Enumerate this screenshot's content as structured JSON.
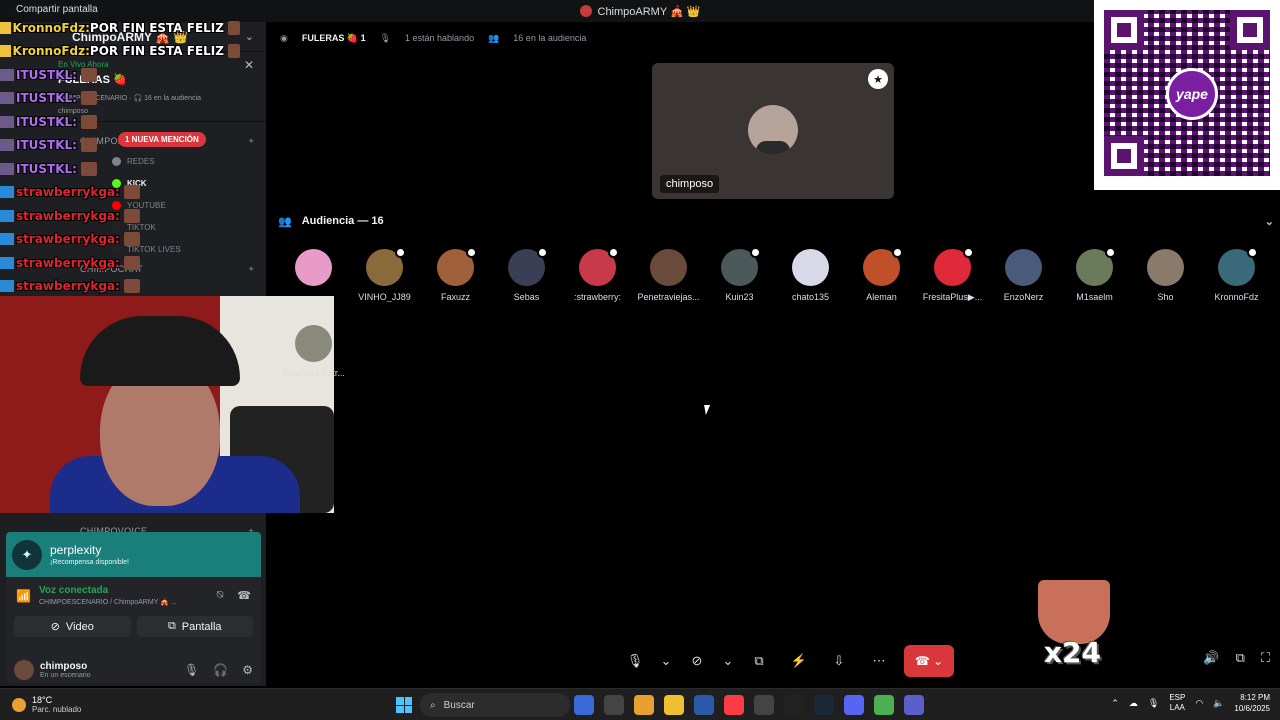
{
  "window": {
    "title": "ChimpoARMY 🎪 👑",
    "share_label": "Compartir pantalla"
  },
  "sidebar": {
    "server_name": "ChimpoARMY 🎪 👑",
    "live_label": "En Vivo Ahora",
    "stage_name": "FULERAS 🍓",
    "stage_meta_scenario": "CHIMPOESCENARIO",
    "stage_meta_audience": "16 en la audiencia",
    "stage_sub": "chimposo",
    "mention_pill": "1 NUEVA MENCIÓN",
    "categories": [
      {
        "label": "CHIMPOREDES"
      },
      {
        "label": "CHIMPOCHAT"
      },
      {
        "label": "CHIMPOVOICE"
      }
    ],
    "channels": [
      {
        "label": "REDES",
        "color": "#80848e"
      },
      {
        "label": "KICK",
        "color": "#53fc18"
      },
      {
        "label": "YOUTUBE",
        "color": "#ff0000"
      },
      {
        "label": "TIKTOK",
        "color": "#222222"
      },
      {
        "label": "TIKTOK LIVES",
        "color": "#222222"
      }
    ]
  },
  "chat_overlay": [
    {
      "nick": "KronnoFdz:",
      "msg": " POR FIN ESTA FELIZ",
      "cls": "nick-kronno"
    },
    {
      "nick": "KronnoFdz:",
      "msg": " POR FIN ESTA FELIZ",
      "cls": "nick-kronno"
    },
    {
      "nick": "ITUSTKL:",
      "msg": "",
      "cls": "nick-itus"
    },
    {
      "nick": "ITUSTKL:",
      "msg": "",
      "cls": "nick-itus"
    },
    {
      "nick": "ITUSTKL:",
      "msg": "",
      "cls": "nick-itus"
    },
    {
      "nick": "ITUSTKL:",
      "msg": "",
      "cls": "nick-itus"
    },
    {
      "nick": "ITUSTKL:",
      "msg": "",
      "cls": "nick-itus"
    },
    {
      "nick": "strawberrykga:",
      "msg": "",
      "cls": "nick-straw"
    },
    {
      "nick": "strawberrykga:",
      "msg": "",
      "cls": "nick-straw"
    },
    {
      "nick": "strawberrykga:",
      "msg": "",
      "cls": "nick-straw"
    },
    {
      "nick": "strawberrykga:",
      "msg": "",
      "cls": "nick-straw"
    },
    {
      "nick": "strawberrykga:",
      "msg": "",
      "cls": "nick-straw"
    }
  ],
  "reward": {
    "title": "perplexity",
    "subtitle": "¡Recompensa disponible!"
  },
  "voice": {
    "status": "Voz conectada",
    "location": "CHIMPOESCENARIO / ChimpoARMY 🎪 ...",
    "video_label": "Video",
    "screen_label": "Pantalla"
  },
  "user": {
    "name": "chimposo",
    "status": "En un escenario"
  },
  "stage": {
    "name": "FULERAS 🍓 1",
    "speaking": "1 están hablando",
    "audience": "16 en la audiencia",
    "speaker_name": "chimposo",
    "audience_header": "Audiencia — 16"
  },
  "audience": [
    {
      "name": "",
      "color": "#e89ac8",
      "badge": false
    },
    {
      "name": "VINHO_JJ89",
      "color": "#8a6a3a",
      "badge": true
    },
    {
      "name": "Faxuzz",
      "color": "#a0603a",
      "badge": true
    },
    {
      "name": "Sebas",
      "color": "#3a3f55",
      "badge": true
    },
    {
      "name": ":strawberry:",
      "color": "#c83a4a",
      "badge": true
    },
    {
      "name": "Penetraviejas...",
      "color": "#6a4a3a",
      "badge": false
    },
    {
      "name": "Kuin23",
      "color": "#4a5a5a",
      "badge": true
    },
    {
      "name": "chato135",
      "color": "#d8d8e8",
      "badge": false
    },
    {
      "name": "Aleman",
      "color": "#c0502a",
      "badge": true
    },
    {
      "name": "FresitaPlus▶...",
      "color": "#e02a3a",
      "badge": true
    },
    {
      "name": "EnzoNerz",
      "color": "#4a5a7a",
      "badge": false
    },
    {
      "name": "M1saelm",
      "color": "#6a7a5a",
      "badge": true
    },
    {
      "name": "Sho",
      "color": "#8a7a6a",
      "badge": false
    },
    {
      "name": "KronnoFdz",
      "color": "#3a6a7a",
      "badge": true
    },
    {
      "name": "Yarens11 Extr...",
      "color": "#8a8a7a",
      "badge": false
    }
  ],
  "overlay_emote": {
    "text": "x24"
  },
  "taskbar": {
    "temp": "18°C",
    "condition": "Parc. nublado",
    "search_placeholder": "Buscar",
    "lang1": "ESP",
    "lang2": "LAA",
    "time": "8:12 PM",
    "date": "10/6/2025",
    "apps": [
      "#3a6ad8",
      "#444",
      "#e8a030",
      "#f0c030",
      "#2a5aa8",
      "#fc3c44",
      "#444",
      "#222",
      "#1b2838",
      "#5865f2",
      "#4caf50",
      "#5b5fc7"
    ]
  }
}
